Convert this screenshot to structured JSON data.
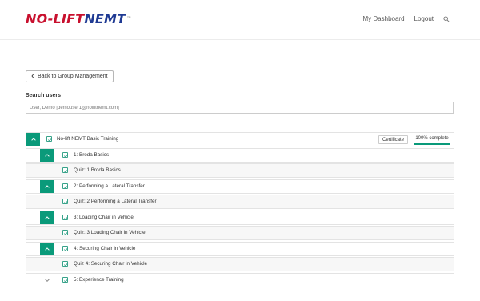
{
  "header": {
    "logo_part1": "NO-LIFT",
    "logo_part2": "NEMT",
    "logo_tm": "™",
    "nav_dashboard": "My Dashboard",
    "nav_logout": "Logout"
  },
  "back_button_label": "Back to Group Management",
  "search": {
    "label": "Search users",
    "value": "User, Demo [demouser1@noliftnemt.com]"
  },
  "course": {
    "title": "No-lift NEMT Basic Training",
    "certificate_label": "Certificate",
    "progress_text": "100% complete",
    "progress_fraction": 1.0
  },
  "items": [
    {
      "label": "1: Broda Basics",
      "level": 1,
      "toggle": "expanded"
    },
    {
      "label": "Quiz: 1 Broda Basics",
      "level": 2,
      "toggle": "none"
    },
    {
      "label": "2: Performing a Lateral Transfer",
      "level": 1,
      "toggle": "expanded"
    },
    {
      "label": "Quiz: 2 Performing a Lateral Transfer",
      "level": 2,
      "toggle": "none"
    },
    {
      "label": "3: Loading Chair in Vehicle",
      "level": 1,
      "toggle": "expanded"
    },
    {
      "label": "Quiz: 3 Loading Chair in Vehicle",
      "level": 2,
      "toggle": "none"
    },
    {
      "label": "4: Securing Chair in Vehicle",
      "level": 1,
      "toggle": "expanded"
    },
    {
      "label": "Quiz 4: Securing Chair in Vehicle",
      "level": 2,
      "toggle": "none"
    },
    {
      "label": "5: Experience Training",
      "level": 1,
      "toggle": "collapsed"
    }
  ],
  "colors": {
    "accent": "#0a9a7a",
    "logo_red": "#c8102e",
    "logo_blue": "#1f3a93"
  }
}
